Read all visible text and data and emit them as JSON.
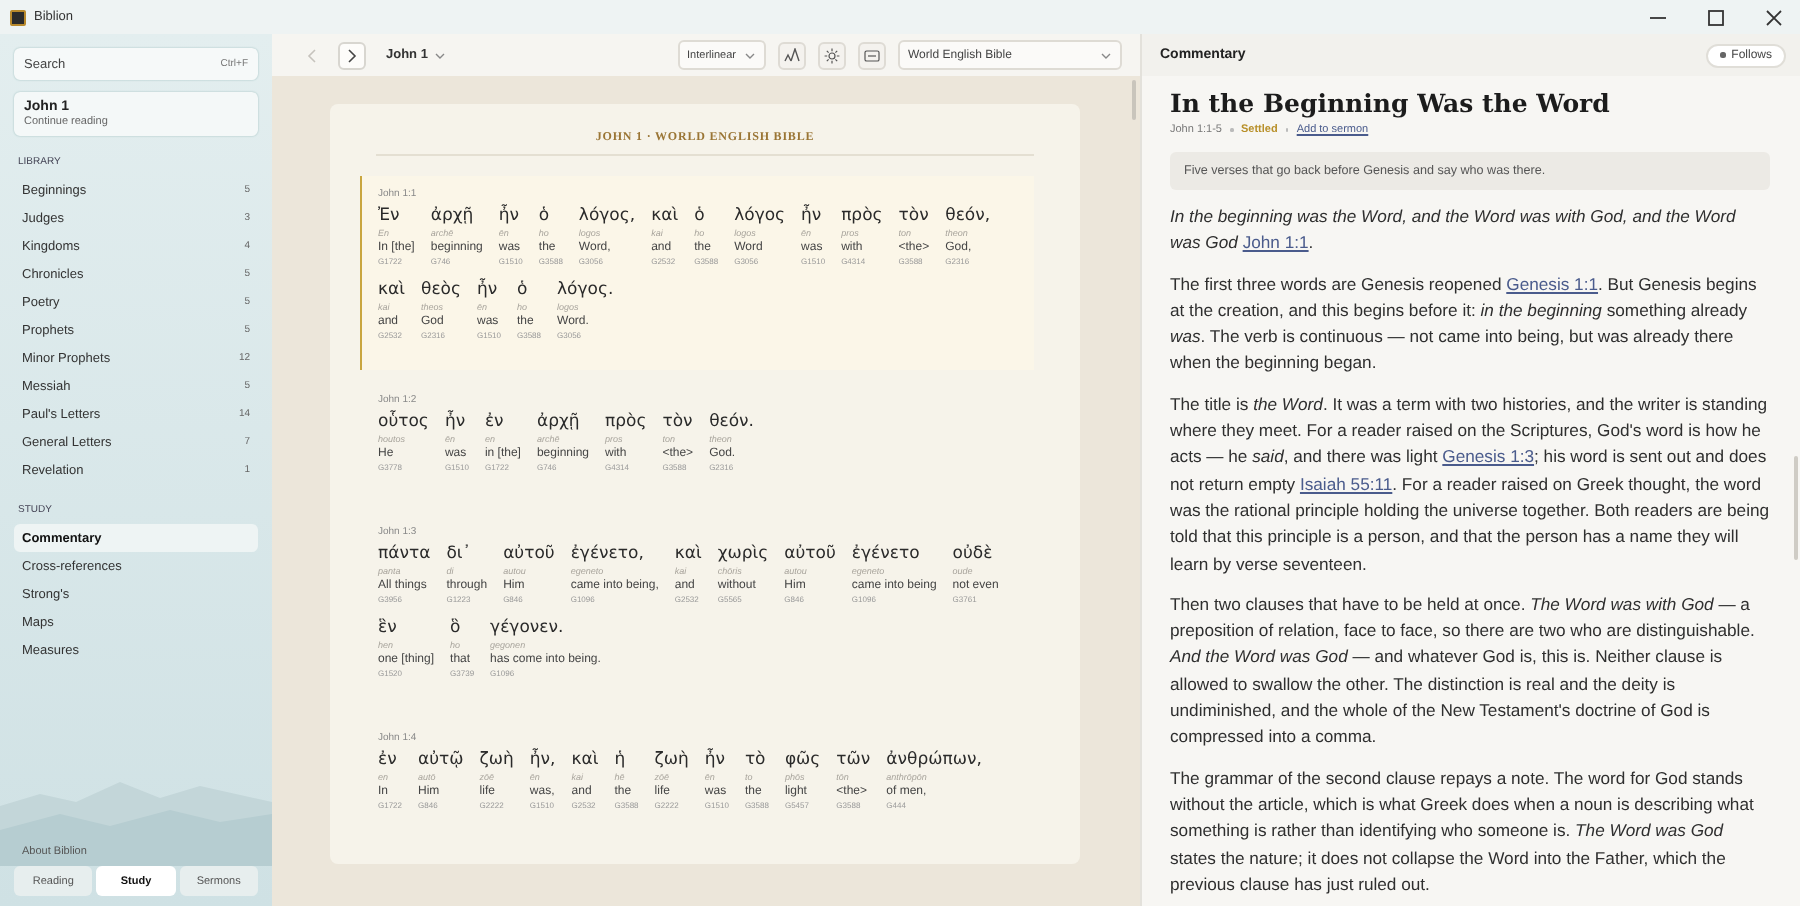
{
  "window": {
    "title": "Biblion"
  },
  "sidebar": {
    "search": {
      "placeholder": "Search",
      "shortcut": "Ctrl+F"
    },
    "continue": {
      "title": "John 1",
      "subtitle": "Continue reading"
    },
    "sections": [
      {
        "heading": "LIBRARY",
        "items": [
          {
            "label": "Beginnings",
            "count": "5",
            "selected": false
          },
          {
            "label": "Judges",
            "count": "3",
            "selected": false
          },
          {
            "label": "Kingdoms",
            "count": "4",
            "selected": false
          },
          {
            "label": "Chronicles",
            "count": "5",
            "selected": false
          },
          {
            "label": "Poetry",
            "count": "5",
            "selected": false
          },
          {
            "label": "Prophets",
            "count": "5",
            "selected": false
          },
          {
            "label": "Minor Prophets",
            "count": "12",
            "selected": false
          },
          {
            "label": "Messiah",
            "count": "5",
            "selected": false
          },
          {
            "label": "Paul's Letters",
            "count": "14",
            "selected": false
          },
          {
            "label": "General Letters",
            "count": "7",
            "selected": false
          },
          {
            "label": "Revelation",
            "count": "1",
            "selected": false
          }
        ]
      },
      {
        "heading": "STUDY",
        "items": [
          {
            "label": "Commentary",
            "selected": true
          },
          {
            "label": "Cross-references",
            "selected": false
          },
          {
            "label": "Strong's",
            "selected": false
          },
          {
            "label": "Maps",
            "selected": false
          },
          {
            "label": "Measures",
            "selected": false
          }
        ]
      }
    ],
    "about": "About Biblion",
    "tabs": [
      {
        "label": "Reading",
        "selected": false
      },
      {
        "label": "Study",
        "selected": true
      },
      {
        "label": "Sermons",
        "selected": false
      }
    ]
  },
  "toolbar": {
    "back": {
      "disabled": true
    },
    "forward": {
      "disabled": false
    },
    "chapter": "John 1",
    "view": "Interlinear",
    "translation": "World English Bible"
  },
  "reader": {
    "heading": "JOHN 1 · WORLD ENGLISH BIBLE",
    "verses": [
      {
        "reference": "John 1:1",
        "selected": true,
        "lines": [
          [
            {
              "greek": "Ἐν",
              "translit": "En",
              "english": "In [the]",
              "strongs": "G1722"
            },
            {
              "greek": "ἀρχῇ",
              "translit": "archē",
              "english": "beginning",
              "strongs": "G746"
            },
            {
              "greek": "ἦν",
              "translit": "ēn",
              "english": "was",
              "strongs": "G1510"
            },
            {
              "greek": "ὁ",
              "translit": "ho",
              "english": "the",
              "strongs": "G3588"
            },
            {
              "greek": "λόγος,",
              "translit": "logos",
              "english": "Word,",
              "strongs": "G3056"
            },
            {
              "greek": "καὶ",
              "translit": "kai",
              "english": "and",
              "strongs": "G2532"
            },
            {
              "greek": "ὁ",
              "translit": "ho",
              "english": "the",
              "strongs": "G3588"
            },
            {
              "greek": "λόγος",
              "translit": "logos",
              "english": "Word",
              "strongs": "G3056"
            },
            {
              "greek": "ἦν",
              "translit": "ēn",
              "english": "was",
              "strongs": "G1510"
            },
            {
              "greek": "πρὸς",
              "translit": "pros",
              "english": "with",
              "strongs": "G4314"
            },
            {
              "greek": "τὸν",
              "translit": "ton",
              "english": "<the>",
              "strongs": "G3588"
            },
            {
              "greek": "θεόν,",
              "translit": "theon",
              "english": "God,",
              "strongs": "G2316"
            }
          ],
          [
            {
              "greek": "καὶ",
              "translit": "kai",
              "english": "and",
              "strongs": "G2532"
            },
            {
              "greek": "θεὸς",
              "translit": "theos",
              "english": "God",
              "strongs": "G2316"
            },
            {
              "greek": "ἦν",
              "translit": "ēn",
              "english": "was",
              "strongs": "G1510"
            },
            {
              "greek": "ὁ",
              "translit": "ho",
              "english": "the",
              "strongs": "G3588"
            },
            {
              "greek": "λόγος.",
              "translit": "logos",
              "english": "Word.",
              "strongs": "G3056"
            }
          ]
        ]
      },
      {
        "reference": "John 1:2",
        "selected": false,
        "lines": [
          [
            {
              "greek": "οὗτος",
              "translit": "houtos",
              "english": "He",
              "strongs": "G3778"
            },
            {
              "greek": "ἦν",
              "translit": "ēn",
              "english": "was",
              "strongs": "G1510"
            },
            {
              "greek": "ἐν",
              "translit": "en",
              "english": "in [the]",
              "strongs": "G1722"
            },
            {
              "greek": "ἀρχῇ",
              "translit": "archē",
              "english": "beginning",
              "strongs": "G746"
            },
            {
              "greek": "πρὸς",
              "translit": "pros",
              "english": "with",
              "strongs": "G4314"
            },
            {
              "greek": "τὸν",
              "translit": "ton",
              "english": "<the>",
              "strongs": "G3588"
            },
            {
              "greek": "θεόν.",
              "translit": "theon",
              "english": "God.",
              "strongs": "G2316"
            }
          ]
        ]
      },
      {
        "reference": "John 1:3",
        "selected": false,
        "lines": [
          [
            {
              "greek": "πάντα",
              "translit": "panta",
              "english": "All things",
              "strongs": "G3956"
            },
            {
              "greek": "δι᾽",
              "translit": "di",
              "english": "through",
              "strongs": "G1223"
            },
            {
              "greek": "αὐτοῦ",
              "translit": "autou",
              "english": "Him",
              "strongs": "G846"
            },
            {
              "greek": "ἐγένετο,",
              "translit": "egeneto",
              "english": "came into being,",
              "strongs": "G1096"
            },
            {
              "greek": "καὶ",
              "translit": "kai",
              "english": "and",
              "strongs": "G2532"
            },
            {
              "greek": "χωρὶς",
              "translit": "chōris",
              "english": "without",
              "strongs": "G5565"
            },
            {
              "greek": "αὐτοῦ",
              "translit": "autou",
              "english": "Him",
              "strongs": "G846"
            },
            {
              "greek": "ἐγένετο",
              "translit": "egeneto",
              "english": "came into being",
              "strongs": "G1096"
            },
            {
              "greek": "οὐδὲ",
              "translit": "oude",
              "english": "not even",
              "strongs": "G3761"
            }
          ],
          [
            {
              "greek": "ἓν",
              "translit": "hen",
              "english": "one [thing]",
              "strongs": "G1520"
            },
            {
              "greek": "ὃ",
              "translit": "ho",
              "english": "that",
              "strongs": "G3739"
            },
            {
              "greek": "γέγονεν.",
              "translit": "gegonen",
              "english": "has come into being.",
              "strongs": "G1096"
            }
          ]
        ]
      },
      {
        "reference": "John 1:4",
        "selected": false,
        "lines": [
          [
            {
              "greek": "ἐν",
              "translit": "en",
              "english": "In",
              "strongs": "G1722"
            },
            {
              "greek": "αὐτῷ",
              "translit": "autō",
              "english": "Him",
              "strongs": "G846"
            },
            {
              "greek": "ζωὴ",
              "translit": "zōē",
              "english": "life",
              "strongs": "G2222"
            },
            {
              "greek": "ἦν,",
              "translit": "ēn",
              "english": "was,",
              "strongs": "G1510"
            },
            {
              "greek": "καὶ",
              "translit": "kai",
              "english": "and",
              "strongs": "G2532"
            },
            {
              "greek": "ἡ",
              "translit": "hē",
              "english": "the",
              "strongs": "G3588"
            },
            {
              "greek": "ζωὴ",
              "translit": "zōē",
              "english": "life",
              "strongs": "G2222"
            },
            {
              "greek": "ἦν",
              "translit": "ēn",
              "english": "was",
              "strongs": "G1510"
            },
            {
              "greek": "τὸ",
              "translit": "to",
              "english": "the",
              "strongs": "G3588"
            },
            {
              "greek": "φῶς",
              "translit": "phōs",
              "english": "light",
              "strongs": "G5457"
            },
            {
              "greek": "τῶν",
              "translit": "tōn",
              "english": "<the>",
              "strongs": "G3588"
            },
            {
              "greek": "ἀνθρώπων,",
              "translit": "anthrōpōn",
              "english": "of men,",
              "strongs": "G444"
            }
          ]
        ]
      }
    ]
  },
  "commentary": {
    "panel_title": "Commentary",
    "follow_button": "Follows",
    "title": "In the Beginning Was the Word",
    "reference": "John 1:1-5",
    "status": "Settled",
    "add_link": "Add to sermon",
    "summary": "Five verses that go back before Genesis and say who was there.",
    "paragraphs": [
      {
        "parts": [
          {
            "kind": "text",
            "text": "*In the beginning was the Word, and the Word was with God, and the Word was God* "
          },
          {
            "kind": "link",
            "text": "John 1:1"
          },
          {
            "kind": "text",
            "text": "."
          }
        ]
      },
      {
        "parts": [
          {
            "kind": "text",
            "text": "The first three words are Genesis reopened "
          },
          {
            "kind": "link",
            "text": "Genesis 1:1"
          },
          {
            "kind": "text",
            "text": ". But Genesis begins at the creation, and this begins before it: *in the beginning* something already *was*. The verb is continuous — not came into being, but was already there when the beginning began."
          }
        ]
      },
      {
        "parts": [
          {
            "kind": "text",
            "text": "The title is *the Word*. It was a term with two histories, and the writer is standing where they meet. For a reader raised on the Scriptures, God's word is how he acts — he *said*, and there was light "
          },
          {
            "kind": "link",
            "text": "Genesis 1:3"
          },
          {
            "kind": "text",
            "text": "; his word is sent out and does not return empty "
          },
          {
            "kind": "link",
            "text": "Isaiah 55:11"
          },
          {
            "kind": "text",
            "text": ". For a reader raised on Greek thought, the word was the rational principle holding the universe together. Both readers are being told that this principle is a person, and that the person has a name they will learn by verse seventeen."
          }
        ]
      },
      {
        "parts": [
          {
            "kind": "text",
            "text": "Then two clauses that have to be held at once. *The Word was with God* — a preposition of relation, face to face, so there are two who are distinguishable. *And the Word was God* — and whatever God is, this is. Neither clause is allowed to swallow the other. The distinction is real and the deity is undiminished, and the whole of the New Testament's doctrine of God is compressed into a comma."
          }
        ]
      },
      {
        "parts": [
          {
            "kind": "text",
            "text": "The grammar of the second clause repays a note. The word for God stands without the article, which is what Greek does when a noun is describing what something is rather than identifying who someone is. *The Word was God* states the nature; it does not collapse the Word into the Father, which the previous clause has just ruled out."
          }
        ]
      }
    ]
  }
}
